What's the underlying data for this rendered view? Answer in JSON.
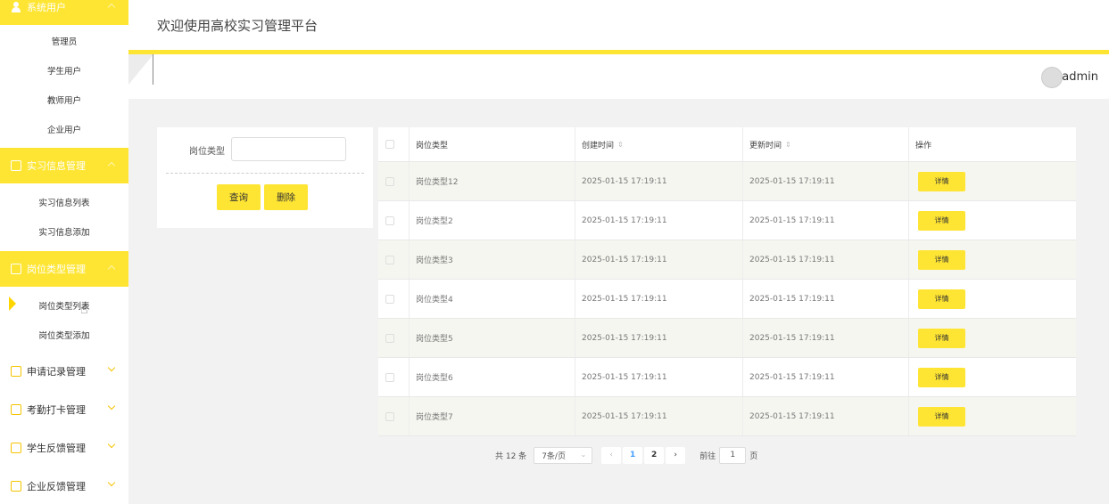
{
  "header": {
    "title": "欢迎使用高校实习管理平台"
  },
  "user": {
    "name": "admin"
  },
  "sidebar": {
    "groups": [
      {
        "label": "系统用户",
        "items": [
          "管理员",
          "学生用户",
          "教师用户",
          "企业用户"
        ]
      },
      {
        "label": "实习信息管理",
        "items": [
          "实习信息列表",
          "实习信息添加"
        ]
      },
      {
        "label": "岗位类型管理",
        "items": [
          "岗位类型列表",
          "岗位类型添加"
        ]
      },
      {
        "label": "申请记录管理"
      },
      {
        "label": "考勤打卡管理"
      },
      {
        "label": "学生反馈管理"
      },
      {
        "label": "企业反馈管理"
      }
    ],
    "active_item": "岗位类型列表"
  },
  "search": {
    "label": "岗位类型",
    "value": "",
    "query_button": "查询",
    "delete_button": "删除"
  },
  "table": {
    "columns": [
      "岗位类型",
      "创建时间",
      "更新时间",
      "操作"
    ],
    "rows": [
      {
        "type": "岗位类型12",
        "created": "2025-01-15 17:19:11",
        "updated": "2025-01-15 17:19:11",
        "action": "详情"
      },
      {
        "type": "岗位类型2",
        "created": "2025-01-15 17:19:11",
        "updated": "2025-01-15 17:19:11",
        "action": "详情"
      },
      {
        "type": "岗位类型3",
        "created": "2025-01-15 17:19:11",
        "updated": "2025-01-15 17:19:11",
        "action": "详情"
      },
      {
        "type": "岗位类型4",
        "created": "2025-01-15 17:19:11",
        "updated": "2025-01-15 17:19:11",
        "action": "详情"
      },
      {
        "type": "岗位类型5",
        "created": "2025-01-15 17:19:11",
        "updated": "2025-01-15 17:19:11",
        "action": "详情"
      },
      {
        "type": "岗位类型6",
        "created": "2025-01-15 17:19:11",
        "updated": "2025-01-15 17:19:11",
        "action": "详情"
      },
      {
        "type": "岗位类型7",
        "created": "2025-01-15 17:19:11",
        "updated": "2025-01-15 17:19:11",
        "action": "详情"
      }
    ]
  },
  "pagination": {
    "total": "共 12 条",
    "page_size": "7条/页",
    "pages": [
      "1",
      "2"
    ],
    "current_page": "1",
    "goto_label": "前往",
    "goto_value": "1",
    "page_suffix": "页"
  },
  "colors": {
    "accent": "#ffe533",
    "page_current": "#409eff"
  }
}
